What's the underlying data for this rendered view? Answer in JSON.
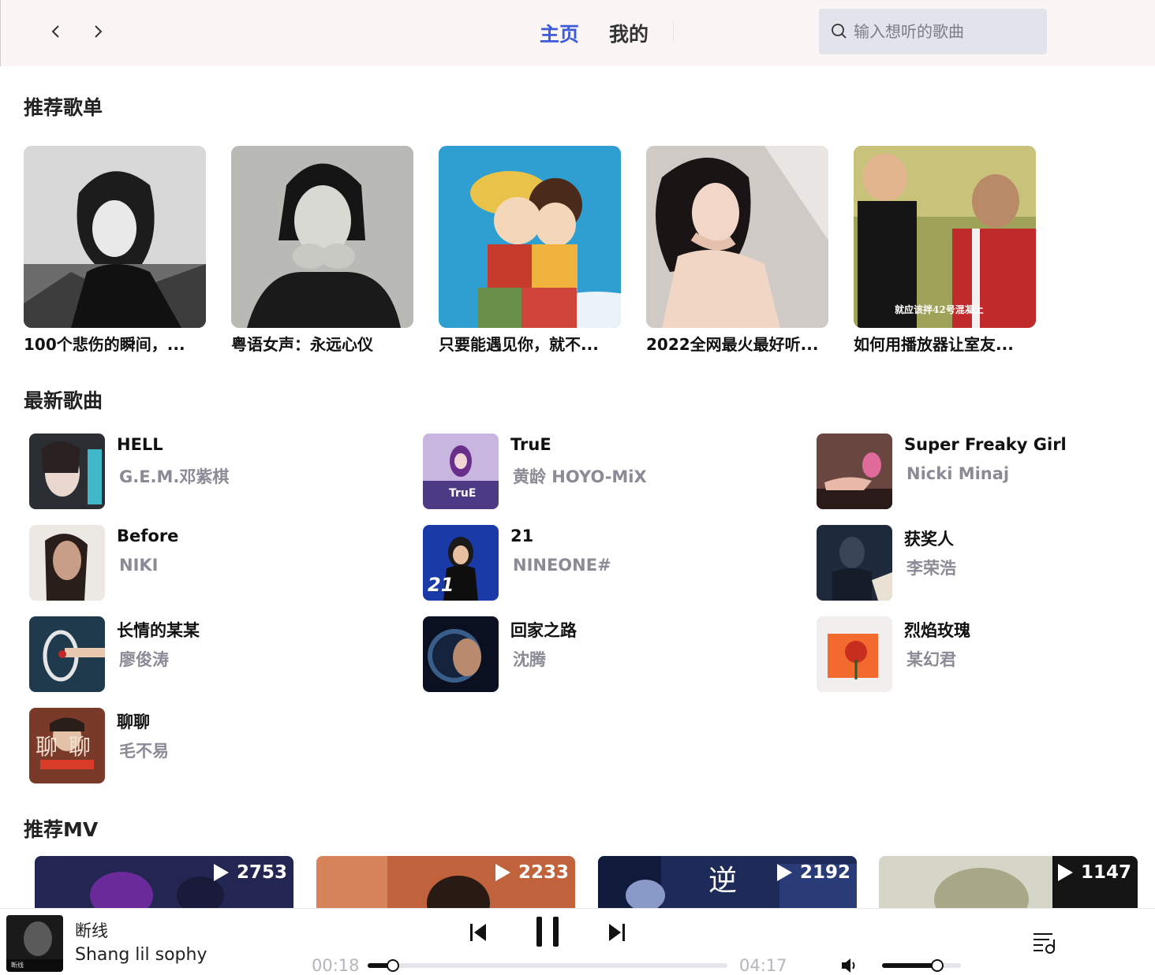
{
  "header": {
    "back_glyph": "‹",
    "forward_glyph": "›",
    "tabs": [
      {
        "label": "主页",
        "active": true
      },
      {
        "label": "我的",
        "active": false
      }
    ],
    "search": {
      "placeholder": "输入想听的歌曲",
      "value": ""
    }
  },
  "sections": {
    "playlists_title": "推荐歌单",
    "songs_title": "最新歌曲",
    "mvs_title": "推荐MV"
  },
  "playlists": [
    {
      "name": "100个悲伤的瞬间，..."
    },
    {
      "name": "粤语女声：永远心仪"
    },
    {
      "name": "只要能遇见你，就不..."
    },
    {
      "name": "2022全网最火最好听..."
    },
    {
      "name": "如何用播放器让室友...",
      "cover_caption": "就应该拌42号混凝土"
    }
  ],
  "songs": [
    {
      "title": "HELL",
      "artist": "G.E.M.邓紫棋"
    },
    {
      "title": "TruE",
      "artist": "黄龄 HOYO-MiX",
      "cover_text": "TruE"
    },
    {
      "title": "Super Freaky Girl",
      "artist": "Nicki Minaj"
    },
    {
      "title": "Before",
      "artist": "NIKI"
    },
    {
      "title": "21",
      "artist": "NINEONE#",
      "cover_text": "21"
    },
    {
      "title": "获奖人",
      "artist": "李荣浩"
    },
    {
      "title": "长情的某某",
      "artist": "廖俊涛"
    },
    {
      "title": "回家之路",
      "artist": "沈腾"
    },
    {
      "title": "烈焰玫瑰",
      "artist": "某幻君"
    },
    {
      "title": "聊聊",
      "artist": "毛不易",
      "cover_text": "聊聊"
    }
  ],
  "mvs": [
    {
      "play_count": "2753"
    },
    {
      "play_count": "2233"
    },
    {
      "play_count": "2192",
      "cover_text": "逆"
    },
    {
      "play_count": "1147"
    }
  ],
  "player": {
    "title": "断线",
    "artist": "Shang lil sophy",
    "current_time": "00:18",
    "total_time": "04:17",
    "progress": 0.07,
    "volume": 0.7,
    "is_playing": true,
    "cover_text": "断线"
  }
}
